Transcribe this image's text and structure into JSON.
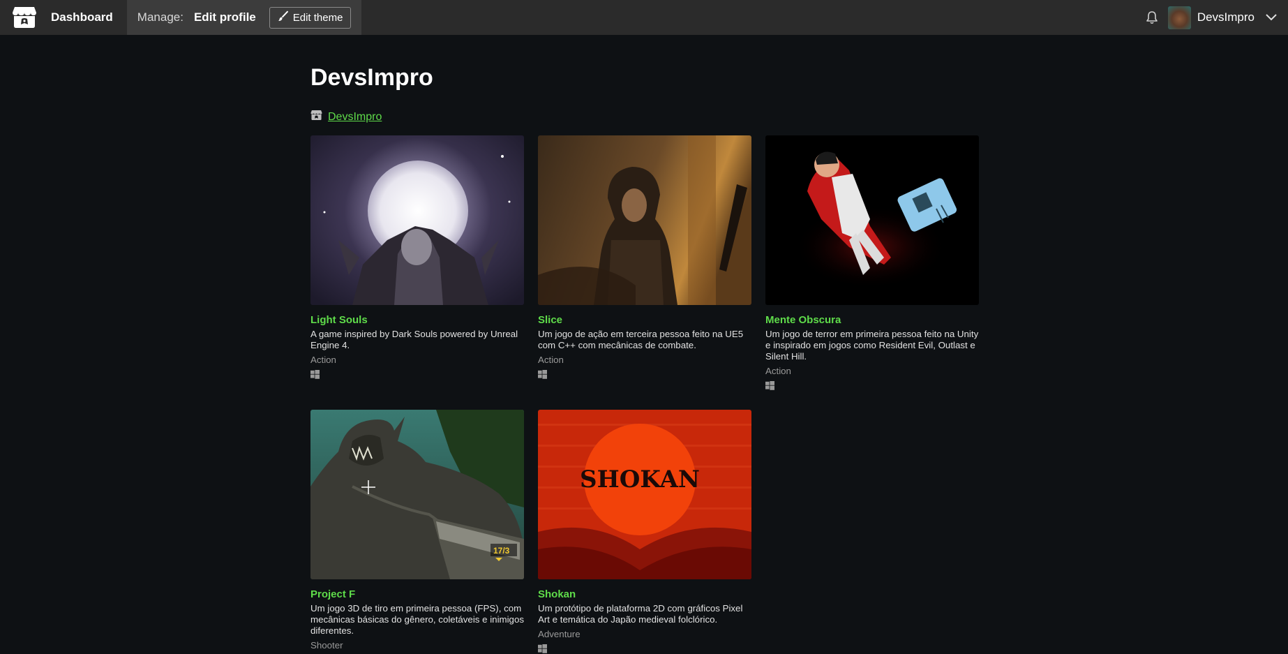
{
  "header": {
    "dashboard_label": "Dashboard",
    "manage_label": "Manage:",
    "edit_profile_label": "Edit profile",
    "edit_theme_label": "Edit theme",
    "user_name": "DevsImpro"
  },
  "profile": {
    "title": "DevsImpro",
    "link_text": "DevsImpro"
  },
  "games": [
    {
      "title": "Light Souls",
      "description": "A game inspired by Dark Souls powered by Unreal Engine 4.",
      "genre": "Action",
      "platform_icon": "windows-icon"
    },
    {
      "title": "Slice",
      "description": "Um jogo de ação em terceira pessoa feito na UE5 com C++ com mecânicas de combate.",
      "genre": "Action",
      "platform_icon": "windows-icon"
    },
    {
      "title": "Mente Obscura",
      "description": "Um jogo de terror em primeira pessoa feito na Unity e inspirado em jogos como Resident Evil, Outlast e Silent Hill.",
      "genre": "Action",
      "platform_icon": "windows-icon"
    },
    {
      "title": "Project F",
      "description": "Um jogo 3D de tiro em primeira pessoa (FPS), com mecânicas básicas do gênero, coletáveis e inimigos diferentes.",
      "genre": "Shooter",
      "ammo_text": "17/3"
    },
    {
      "title": "Shokan",
      "description": "Um protótipo de plataforma 2D com gráficos Pixel Art e temática do Japão medieval folclórico.",
      "genre": "Adventure",
      "cover_text": "SHOKAN",
      "platform_icon": "windows-icon"
    }
  ],
  "colors": {
    "background": "#0e1114",
    "topbar": "#2b2b2b",
    "link_green": "#5fdc4a"
  }
}
